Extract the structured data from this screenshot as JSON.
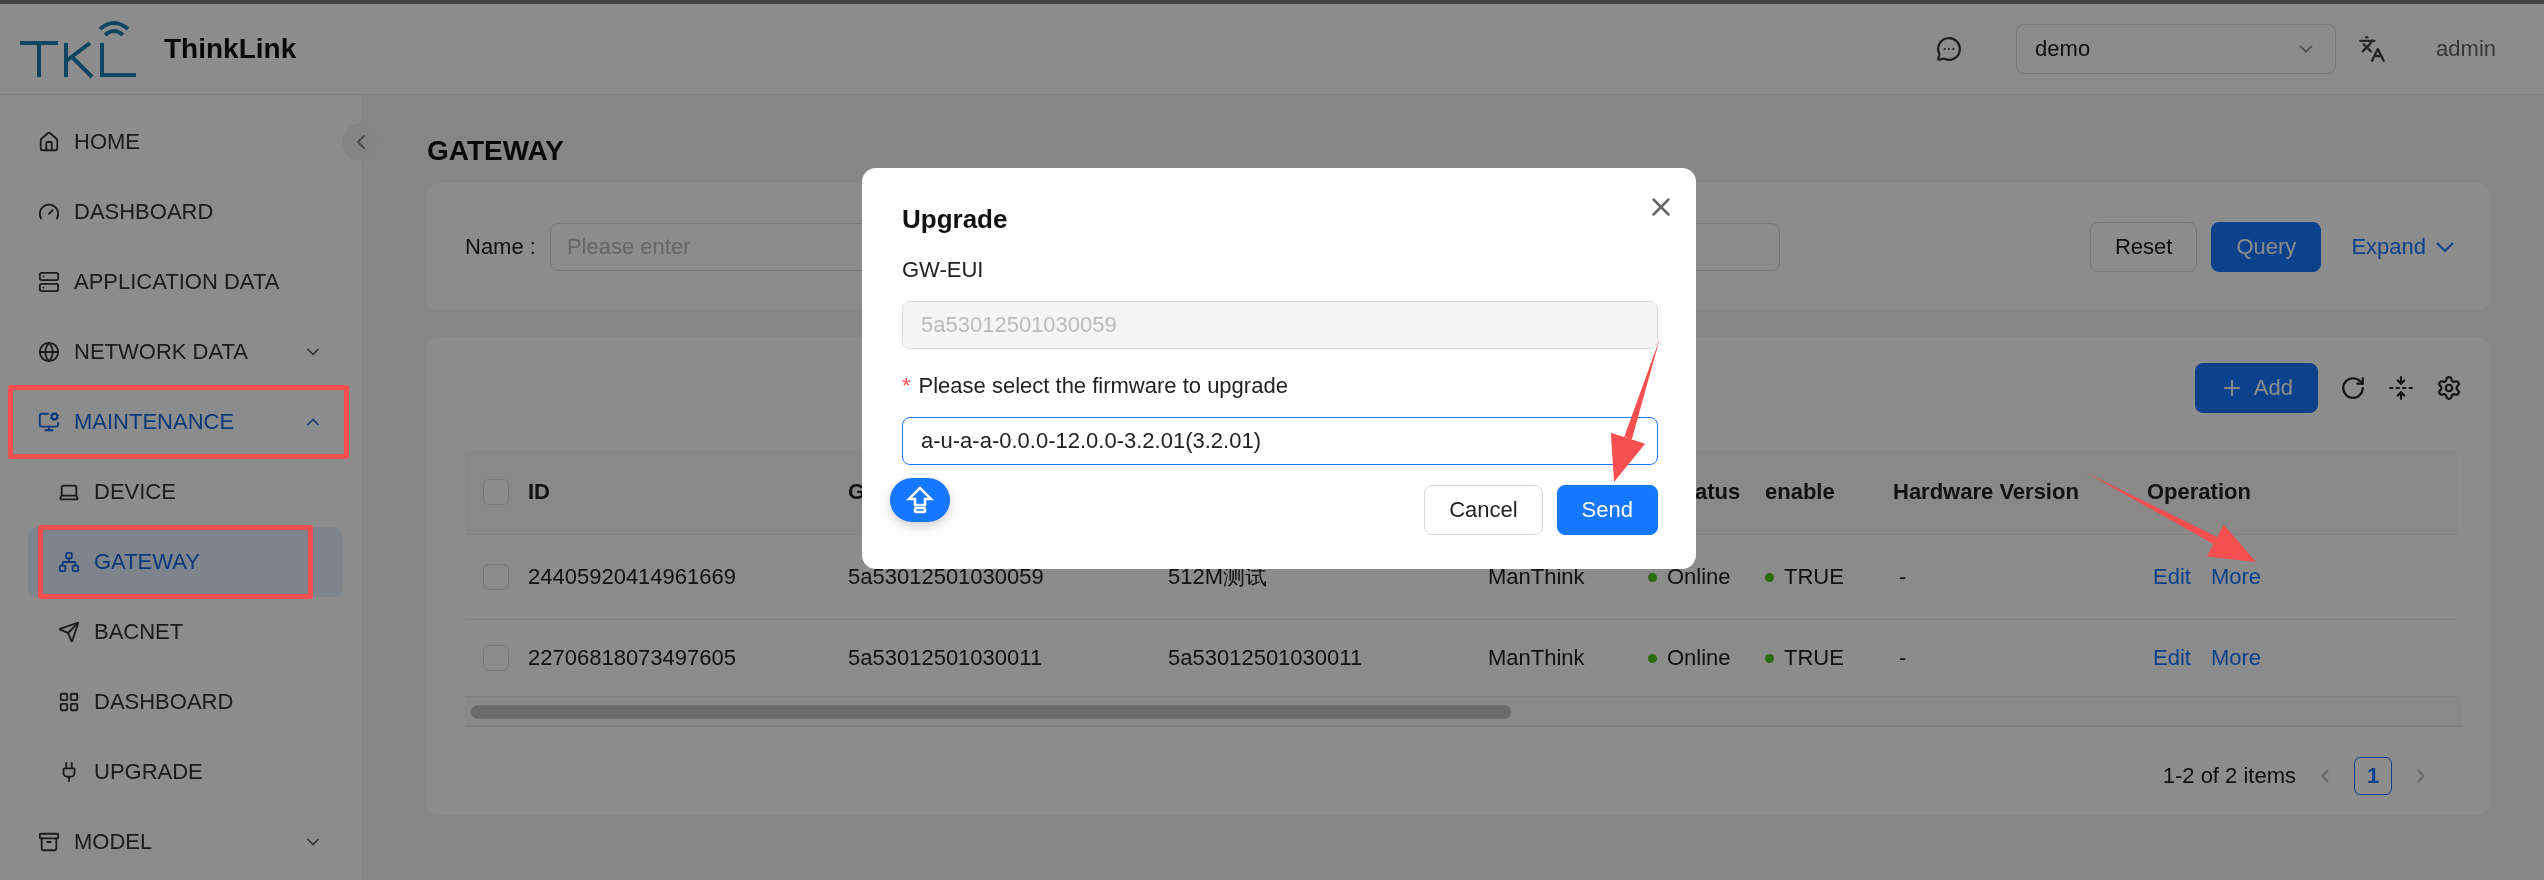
{
  "brand": {
    "name": "ThinkLink"
  },
  "header": {
    "project": "demo",
    "user": "admin"
  },
  "sidebar": {
    "items": [
      {
        "label": "HOME",
        "selected": false
      },
      {
        "label": "DASHBOARD",
        "selected": false
      },
      {
        "label": "APPLICATION DATA",
        "selected": false
      },
      {
        "label": "NETWORK DATA",
        "selected": false,
        "expanded": false
      },
      {
        "label": "MAINTENANCE",
        "selected": false,
        "expanded": true,
        "annotated": true,
        "children": [
          {
            "label": "DEVICE",
            "selected": false
          },
          {
            "label": "GATEWAY",
            "selected": true,
            "annotated": true
          },
          {
            "label": "BACNET",
            "selected": false
          },
          {
            "label": "DASHBOARD",
            "selected": false
          },
          {
            "label": "UPGRADE",
            "selected": false
          }
        ]
      },
      {
        "label": "MODEL",
        "selected": false,
        "expanded": false
      }
    ]
  },
  "page_title": "GATEWAY",
  "filter": {
    "name_label": "Name :",
    "name_placeholder": "Please enter",
    "buttons": [
      "Reset",
      "Query"
    ],
    "expand": "Expand"
  },
  "toolbar": {
    "add": "Add"
  },
  "table": {
    "select_all_checked": false,
    "columns": [
      {
        "label": "ID"
      },
      {
        "label": "G"
      },
      {},
      {},
      {
        "label": "atus"
      },
      {
        "label": "enable"
      },
      {
        "label": "Hardware Version"
      },
      {
        "label": "Operation"
      }
    ],
    "rows": [
      {
        "checked": false,
        "id": "24405920414961669",
        "gw_eui": "5a53012501030059",
        "column_3": "512M测试",
        "column_4": "ManThink",
        "status": {
          "text": "Online",
          "color": "#2d6c0e"
        },
        "enable": {
          "text": "TRUE",
          "color": "#2d6c0e"
        },
        "hardware_version": "-",
        "operations": [
          "Edit",
          "More"
        ]
      },
      {
        "checked": false,
        "id": "22706818073497605",
        "gw_eui": "5a53012501030011",
        "column_3": "5a53012501030011",
        "column_4": "ManThink",
        "status": {
          "text": "Online",
          "color": "#2d6c0e"
        },
        "enable": {
          "text": "TRUE",
          "color": "#2d6c0e"
        },
        "hardware_version": "-",
        "operations": [
          "Edit",
          "More"
        ]
      }
    ]
  },
  "pagination": {
    "summary": "1-2 of 2 items",
    "pages": [
      {
        "label": "1",
        "selected": true
      }
    ]
  },
  "modal": {
    "title": "Upgrade",
    "eui_label": "GW-EUI",
    "eui_value": "5a53012501030059",
    "firmware_label": "Please select the firmware to upgrade",
    "firmware_required": true,
    "required_mark": "*",
    "firmware_value": "a-u-a-a-0.0.0-12.0.0-3.2.01(3.2.01)",
    "buttons": [
      "Cancel",
      "Send"
    ]
  }
}
